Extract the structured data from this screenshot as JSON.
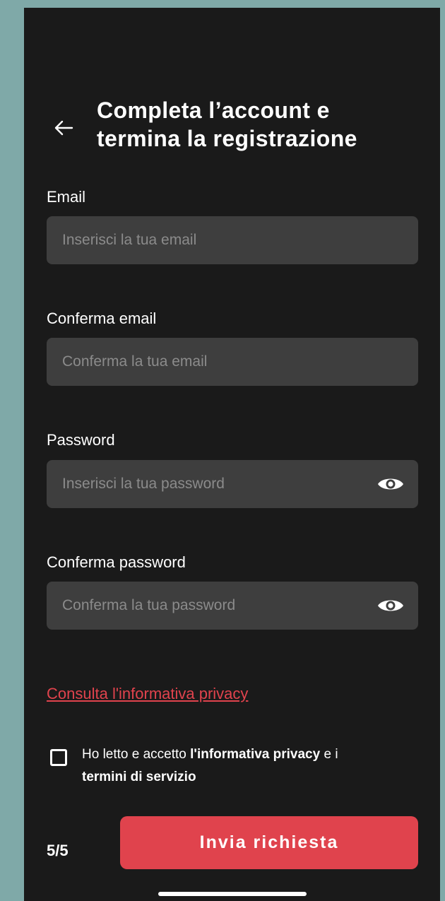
{
  "header": {
    "back_icon": "arrow-left-icon",
    "title_line1": "Completa l’account e",
    "title_line2": "termina la registrazione"
  },
  "form": {
    "email": {
      "label": "Email",
      "placeholder": "Inserisci la tua email"
    },
    "confirm_email": {
      "label": "Conferma email",
      "placeholder": "Conferma la tua email"
    },
    "password": {
      "label": "Password",
      "placeholder": "Inserisci la tua password",
      "icon": "eye-icon"
    },
    "confirm_password": {
      "label": "Conferma password",
      "placeholder": "Conferma la tua password",
      "icon": "eye-icon"
    }
  },
  "privacy_link": "Consulta l'informativa privacy",
  "consent": {
    "checked": false,
    "text_1": "Ho letto e accetto ",
    "bold_1": "l'informativa privacy",
    "text_2": " e i ",
    "bold_2": "termini di servizio"
  },
  "footer": {
    "step": "5/5",
    "submit_label": "Invia richiesta"
  },
  "colors": {
    "background": "#1a1a1a",
    "accent": "#e0434d",
    "field": "#3e3e3e",
    "page_frame": "#7fa9a8"
  }
}
